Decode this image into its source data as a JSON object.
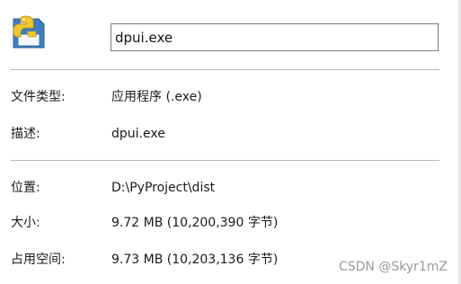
{
  "general": {
    "file_name": "dpui.exe",
    "file_icon": "python-floppy-icon"
  },
  "details": {
    "type": {
      "label": "文件类型:",
      "value": "应用程序 (.exe)"
    },
    "description": {
      "label": "描述:",
      "value": "dpui.exe"
    },
    "location": {
      "label": "位置:",
      "value": "D:\\PyProject\\dist"
    },
    "size": {
      "label": "大小:",
      "value": "9.72 MB (10,200,390 字节)"
    },
    "size_on_disk": {
      "label": "占用空间:",
      "value": "9.73 MB (10,203,136 字节)"
    }
  },
  "watermark": "CSDN @Skyr1mZ"
}
